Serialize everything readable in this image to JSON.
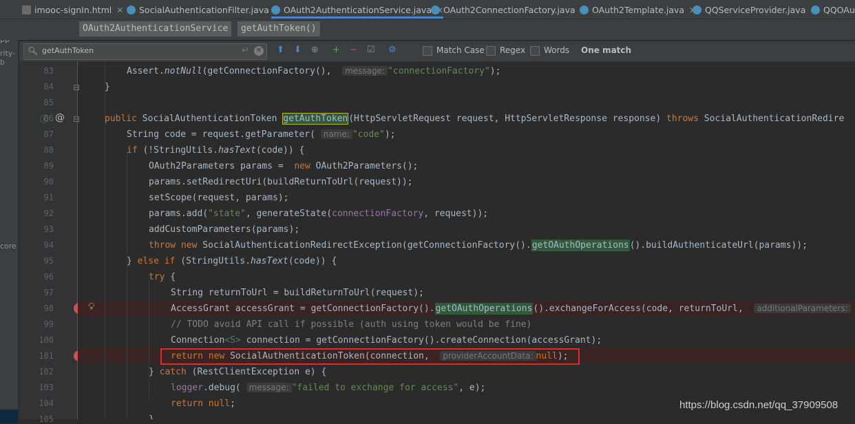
{
  "tabs": [
    {
      "label": "imooc-signIn.html",
      "icon": "html-file-icon"
    },
    {
      "label": "SocialAuthenticationFilter.java",
      "icon": "class-icon"
    },
    {
      "label": "OAuth2AuthenticationService.java",
      "icon": "class-icon",
      "active": true
    },
    {
      "label": "OAuth2ConnectionFactory.java",
      "icon": "class-icon"
    },
    {
      "label": "OAuth2Template.java",
      "icon": "class-icon"
    },
    {
      "label": "QQServiceProvider.java",
      "icon": "class-icon"
    },
    {
      "label": "QQOAu",
      "icon": "class-icon"
    }
  ],
  "breadcrumb": [
    "OAuth2AuthenticationService",
    "getAuthToken()"
  ],
  "find": {
    "value": "getAuthToken",
    "match_case": "Match Case",
    "regex": "Regex",
    "words": "Words",
    "result": "One match"
  },
  "left_panel": {
    "frag1": "pp",
    "frag2": "rity-b",
    "frag3": "core"
  },
  "line_numbers": [
    "83",
    "84",
    "85",
    "86",
    "87",
    "88",
    "89",
    "90",
    "91",
    "92",
    "93",
    "94",
    "95",
    "96",
    "97",
    "98",
    "99",
    "100",
    "101",
    "102",
    "103",
    "104",
    "105"
  ],
  "code": {
    "l83": {
      "pre": "Assert.",
      "method": "notNull",
      "mid": "(getConnectionFactory(), ",
      "hint": "message:",
      "str": "\"connectionFactory\"",
      "end": ");"
    },
    "l84": "}",
    "l86": {
      "kw": "public",
      "type": " SocialAuthenticationToken ",
      "match": "getAuthToken",
      "params": "(HttpServletRequest request, HttpServletResponse response) ",
      "throws": "throws",
      "rest": " SocialAuthenticationRedire"
    },
    "l87": {
      "pre": "String code = request.getParameter(",
      "hint": "name:",
      "str": "\"code\"",
      "end": ");"
    },
    "l88": {
      "kw": "if",
      "pre": " (!StringUtils.",
      "method": "hasText",
      "end": "(code)) {"
    },
    "l89": {
      "pre": "OAuth2Parameters params = ",
      "kw": "new",
      "end": " OAuth2Parameters();"
    },
    "l90": "params.setRedirectUri(buildReturnToUrl(request));",
    "l91": "setScope(request, params);",
    "l92": {
      "pre": "params.add(",
      "str": "\"state\"",
      "mid": ", generateState(",
      "fld": "connectionFactory",
      "end": ", request));"
    },
    "l93": "addCustomParameters(params);",
    "l94": {
      "kw1": "throw",
      "kw2": "new",
      "pre": " SocialAuthenticationRedirectException(getConnectionFactory().",
      "hl": "getOAuthOperations",
      "end": "().buildAuthenticateUrl(params));"
    },
    "l95": {
      "pre": "} ",
      "kw1": "else",
      "kw2": "if",
      "mid": " (StringUtils.",
      "method": "hasText",
      "end": "(code)) {"
    },
    "l96": {
      "kw": "try",
      "end": " {"
    },
    "l97": {
      "pre": "String returnToUrl = buildReturnToUrl(request);"
    },
    "l98": {
      "pre": "AccessGrant accessGrant = getConnectionFactory().",
      "hl": "getOAuthOperations",
      "mid": "().exchangeForAccess(code, returnToUrl, ",
      "hint": "additionalParameters:"
    },
    "l99": "// TODO avoid API call if possible (auth using token would be fine)",
    "l100": {
      "pre": "Connection",
      "gen": "<S>",
      "end": " connection = getConnectionFactory().createConnection(accessGrant);"
    },
    "l101": {
      "kw1": "return",
      "kw2": "new",
      "pre": " SocialAuthenticationToken(connection, ",
      "hint": "providerAccountData:",
      "null": "null",
      "end": ");"
    },
    "l102": {
      "pre": "} ",
      "kw": "catch",
      "end": " (RestClientException e) {"
    },
    "l103": {
      "fld": "logger",
      "pre": ".debug(",
      "hint": "message:",
      "str": "\"failed to exchange for access\"",
      "end": ", e);"
    },
    "l104": {
      "kw": "return",
      "null": "null",
      "end": ";"
    },
    "l105": "}"
  },
  "watermark": "https://blog.csdn.net/qq_37909508",
  "colors": {
    "keyword": "#cc7832",
    "string": "#6a8759",
    "breakpoint": "#c75450",
    "highlight_box": "#e52a2a"
  }
}
